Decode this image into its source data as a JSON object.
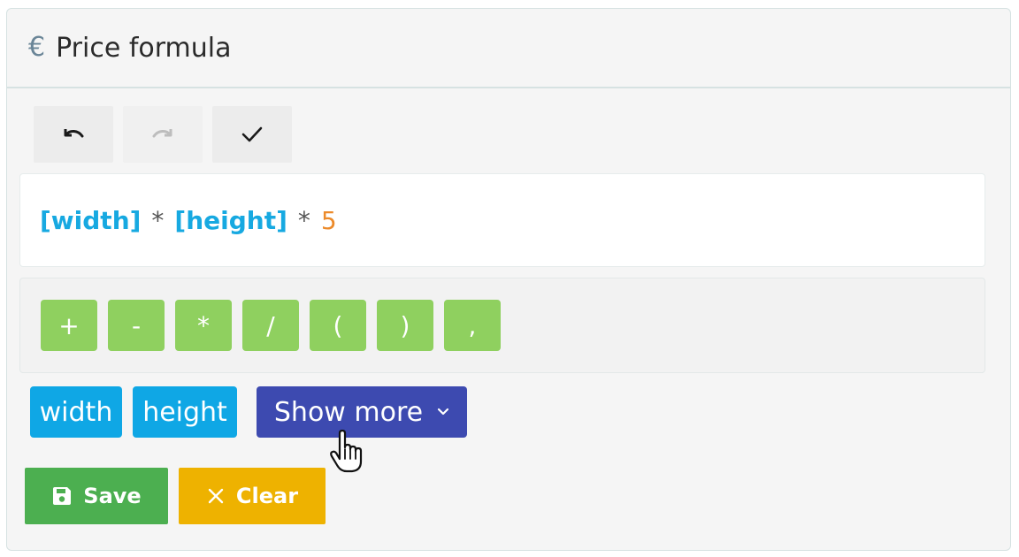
{
  "header": {
    "icon": "euro-icon",
    "icon_glyph": "€",
    "title": "Price formula"
  },
  "toolbar": [
    {
      "name": "undo",
      "icon": "undo-icon",
      "enabled": true
    },
    {
      "name": "redo",
      "icon": "redo-icon",
      "enabled": false
    },
    {
      "name": "validate",
      "icon": "check-icon",
      "enabled": true
    }
  ],
  "formula": {
    "tokens": [
      {
        "type": "variable",
        "text": "[width]"
      },
      {
        "type": "operator",
        "text": "*"
      },
      {
        "type": "variable",
        "text": "[height]"
      },
      {
        "type": "operator",
        "text": "*"
      },
      {
        "type": "number",
        "text": "5"
      }
    ]
  },
  "operators": [
    "+",
    "-",
    "*",
    "/",
    "(",
    ")",
    ","
  ],
  "variables": [
    "width",
    "height"
  ],
  "show_more": {
    "label": "Show more",
    "icon": "chevron-down-icon"
  },
  "actions": {
    "save": {
      "label": "Save",
      "icon": "floppy-disk-icon"
    },
    "clear": {
      "label": "Clear",
      "icon": "close-icon"
    }
  },
  "colors": {
    "variable_token": "#17a9e1",
    "number_token": "#ec8a2a",
    "operator_button": "#8fd05f",
    "variable_button": "#0fa7e5",
    "show_more_button": "#3d4ab0",
    "save_button": "#4caf50",
    "clear_button": "#eeb200"
  }
}
